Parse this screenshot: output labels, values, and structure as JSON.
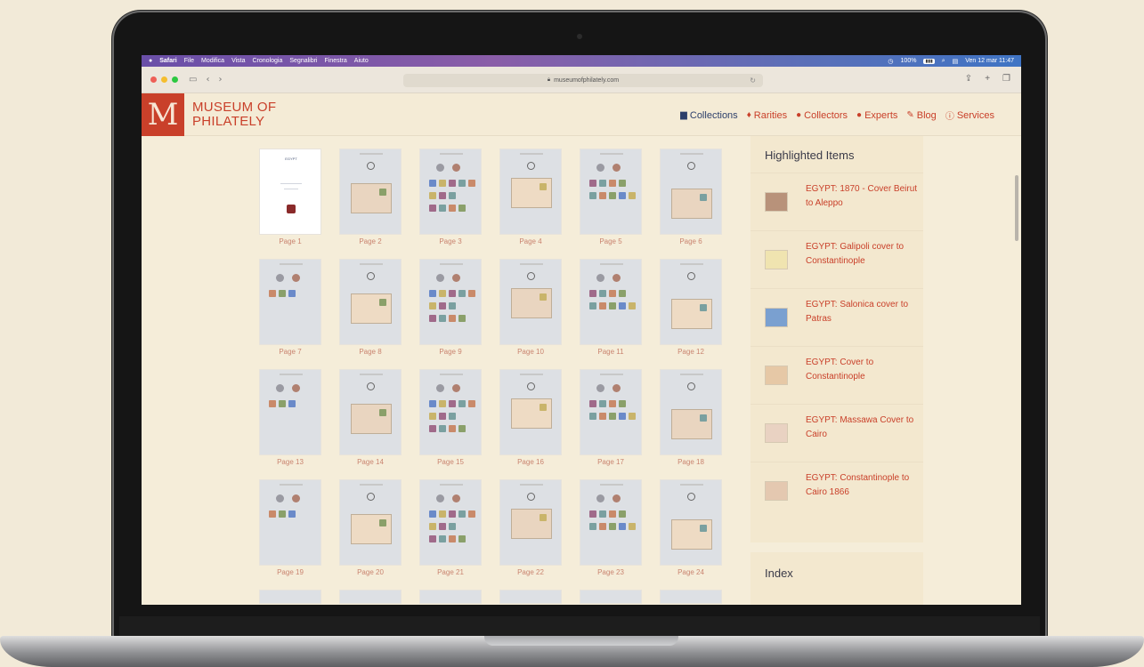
{
  "menubar": {
    "apple": "",
    "items": [
      "Safari",
      "File",
      "Modifica",
      "Vista",
      "Cronologia",
      "Segnalibri",
      "Finestra",
      "Aiuto"
    ],
    "battery": "100%",
    "datetime": "Ven 12 mar  11:47"
  },
  "browser": {
    "url": "museumofphilately.com"
  },
  "site": {
    "logo_letter": "M",
    "logo_line1": "MUSEUM OF",
    "logo_line2": "PHILATELY",
    "nav": [
      {
        "label": "Collections",
        "icon": "book-icon"
      },
      {
        "label": "Rarities",
        "icon": "gem-icon"
      },
      {
        "label": "Collectors",
        "icon": "user-icon"
      },
      {
        "label": "Experts",
        "icon": "user-icon"
      },
      {
        "label": "Blog",
        "icon": "pen-icon"
      },
      {
        "label": "Services",
        "icon": "info-icon"
      }
    ]
  },
  "gallery": {
    "pages": [
      "Page 1",
      "Page 2",
      "Page 3",
      "Page 4",
      "Page 5",
      "Page 6",
      "Page 7",
      "Page 8",
      "Page 9",
      "Page 10",
      "Page 11",
      "Page 12",
      "Page 13",
      "Page 14",
      "Page 15",
      "Page 16",
      "Page 17",
      "Page 18",
      "Page 19",
      "Page 20",
      "Page 21",
      "Page 22",
      "Page 23",
      "Page 24"
    ]
  },
  "sidebar": {
    "title": "Highlighted Items",
    "items": [
      {
        "title": "EGYPT: 1870 - Cover Beirut to Aleppo"
      },
      {
        "title": "EGYPT: Galipoli cover to Constantinople"
      },
      {
        "title": "EGYPT: Salonica cover to Patras"
      },
      {
        "title": "EGYPT: Cover to Constantinople"
      },
      {
        "title": "EGYPT: Massawa Cover to Cairo"
      },
      {
        "title": "EGYPT: Constantinople to Cairo 1866"
      }
    ],
    "index_title": "Index"
  },
  "colors": {
    "brand": "#c9402a",
    "nav_active": "#2d3f6a",
    "page_bg": "#f5edd9"
  }
}
